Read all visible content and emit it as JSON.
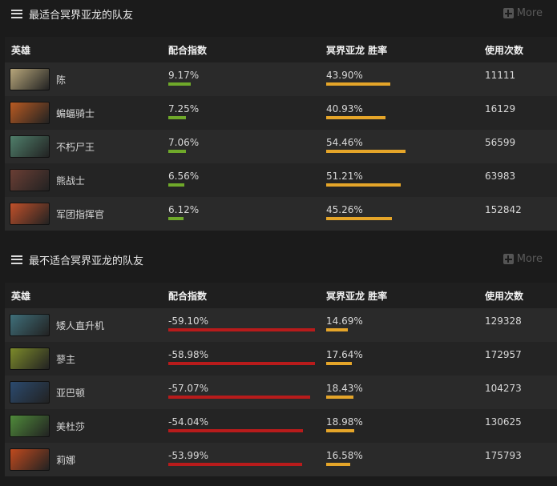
{
  "best": {
    "title": "最适合冥界亚龙的队友",
    "more_label": "More",
    "headers": {
      "hero": "英雄",
      "synergy": "配合指数",
      "winrate": "冥界亚龙 胜率",
      "uses": "使用次数"
    },
    "rows": [
      {
        "hero": "陈",
        "synergy": "9.17%",
        "synergy_pct": 9.17,
        "winrate": "43.90%",
        "winrate_pct": 43.9,
        "uses": "11111",
        "avatar_color": "#b7a67a"
      },
      {
        "hero": "蝙蝠骑士",
        "synergy": "7.25%",
        "synergy_pct": 7.25,
        "winrate": "40.93%",
        "winrate_pct": 40.93,
        "uses": "16129",
        "avatar_color": "#b85a22"
      },
      {
        "hero": "不朽尸王",
        "synergy": "7.06%",
        "synergy_pct": 7.06,
        "winrate": "54.46%",
        "winrate_pct": 54.46,
        "uses": "56599",
        "avatar_color": "#4f7e6a"
      },
      {
        "hero": "熊战士",
        "synergy": "6.56%",
        "synergy_pct": 6.56,
        "winrate": "51.21%",
        "winrate_pct": 51.21,
        "uses": "63983",
        "avatar_color": "#6a3e34"
      },
      {
        "hero": "军团指挥官",
        "synergy": "6.12%",
        "synergy_pct": 6.12,
        "winrate": "45.26%",
        "winrate_pct": 45.26,
        "uses": "152842",
        "avatar_color": "#c0502a"
      }
    ]
  },
  "worst": {
    "title": "最不适合冥界亚龙的队友",
    "more_label": "More",
    "headers": {
      "hero": "英雄",
      "synergy": "配合指数",
      "winrate": "冥界亚龙 胜率",
      "uses": "使用次数"
    },
    "rows": [
      {
        "hero": "矮人直升机",
        "synergy": "-59.10%",
        "synergy_pct": 59.1,
        "winrate": "14.69%",
        "winrate_pct": 14.69,
        "uses": "129328",
        "avatar_color": "#3f6f7a"
      },
      {
        "hero": "蓼主",
        "synergy": "-58.98%",
        "synergy_pct": 58.98,
        "winrate": "17.64%",
        "winrate_pct": 17.64,
        "uses": "172957",
        "avatar_color": "#7c8a2a"
      },
      {
        "hero": "亚巴顿",
        "synergy": "-57.07%",
        "synergy_pct": 57.07,
        "winrate": "18.43%",
        "winrate_pct": 18.43,
        "uses": "104273",
        "avatar_color": "#2b4a6e"
      },
      {
        "hero": "美杜莎",
        "synergy": "-54.04%",
        "synergy_pct": 54.04,
        "winrate": "18.98%",
        "winrate_pct": 18.98,
        "uses": "130625",
        "avatar_color": "#4f8a3a"
      },
      {
        "hero": "莉娜",
        "synergy": "-53.99%",
        "synergy_pct": 53.99,
        "winrate": "16.58%",
        "winrate_pct": 16.58,
        "uses": "175793",
        "avatar_color": "#c04a1e"
      }
    ]
  },
  "colors": {
    "synergy_positive": "#6fa92a",
    "synergy_negative": "#b81b1b",
    "winrate": "#e5a529"
  }
}
